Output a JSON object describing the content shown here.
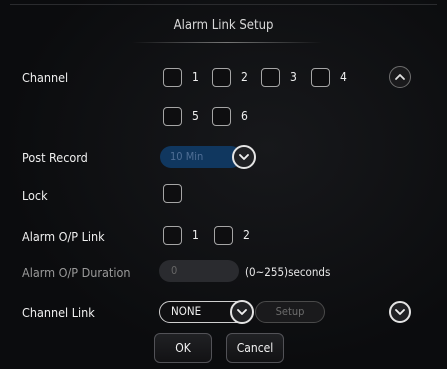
{
  "dialog": {
    "title": "Alarm Link Setup"
  },
  "channel": {
    "label": "Channel",
    "checkboxes": [
      {
        "num": "1",
        "checked": false
      },
      {
        "num": "2",
        "checked": false
      },
      {
        "num": "3",
        "checked": false
      },
      {
        "num": "4",
        "checked": false
      },
      {
        "num": "5",
        "checked": false
      },
      {
        "num": "6",
        "checked": false
      }
    ]
  },
  "post_record": {
    "label": "Post Record",
    "value": "10 Min"
  },
  "lock": {
    "label": "Lock",
    "checked": false
  },
  "alarm_op_link": {
    "label": "Alarm O/P Link",
    "checkboxes": [
      {
        "num": "1",
        "checked": false
      },
      {
        "num": "2",
        "checked": false
      }
    ]
  },
  "alarm_op_duration": {
    "label": "Alarm O/P Duration",
    "value": "0",
    "hint": "(0~255)seconds"
  },
  "channel_link": {
    "label": "Channel Link",
    "value": "NONE",
    "setup_label": "Setup"
  },
  "buttons": {
    "ok": "OK",
    "cancel": "Cancel"
  },
  "icons": {
    "scroll_up": "chevron-up-icon",
    "scroll_down": "chevron-down-icon",
    "dropdown": "chevron-down-icon"
  },
  "colors": {
    "background": "#0b0c0e",
    "disabled_select": "#10375f",
    "text": "#f0f0f0"
  }
}
